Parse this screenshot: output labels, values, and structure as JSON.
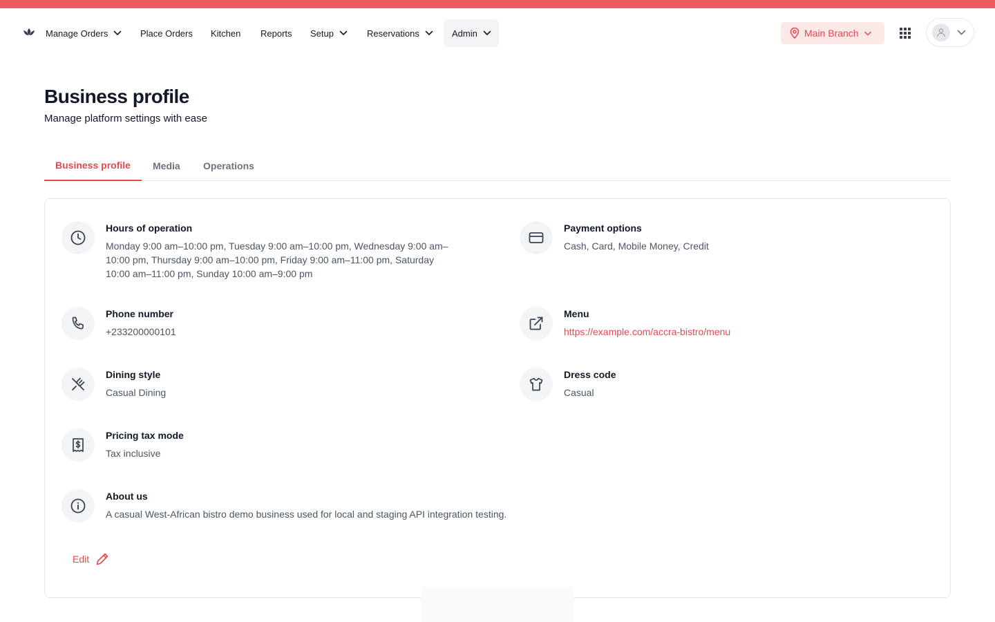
{
  "nav": {
    "items": [
      {
        "label": "Manage Orders",
        "has_dropdown": true
      },
      {
        "label": "Place Orders",
        "has_dropdown": false
      },
      {
        "label": "Kitchen",
        "has_dropdown": false
      },
      {
        "label": "Reports",
        "has_dropdown": false
      },
      {
        "label": "Setup",
        "has_dropdown": true
      },
      {
        "label": "Reservations",
        "has_dropdown": true
      },
      {
        "label": "Admin",
        "has_dropdown": true,
        "active": true
      }
    ],
    "branch": "Main Branch",
    "icons": {
      "logo": "lotus-logo-icon",
      "apps": "grid-apps-icon",
      "user": "user-avatar-icon",
      "branch": "map-pin-icon"
    }
  },
  "page": {
    "title": "Business profile",
    "subtitle": "Manage platform settings with ease"
  },
  "tabs": [
    {
      "label": "Business profile",
      "active": true
    },
    {
      "label": "Media",
      "active": false
    },
    {
      "label": "Operations",
      "active": false
    }
  ],
  "profile": {
    "hours": {
      "label": "Hours of operation",
      "value_lines": [
        "Monday 9:00 am–10:00 pm, Tuesday 9:00 am–10:00 pm, Wednesday 9:00 am–",
        "10:00 pm, Thursday 9:00 am–10:00 pm, Friday 9:00 am–11:00 pm, Saturday",
        "10:00 am–11:00 pm, Sunday 10:00 am–9:00 pm"
      ],
      "icon": "clock-icon"
    },
    "payment": {
      "label": "Payment options",
      "value": "Cash, Card, Mobile Money, Credit",
      "icon": "credit-card-icon"
    },
    "phone": {
      "label": "Phone number",
      "value": "+233200000101",
      "icon": "phone-icon"
    },
    "menu": {
      "label": "Menu",
      "value": "https://example.com/accra-bistro/menu",
      "icon": "external-link-icon"
    },
    "dining": {
      "label": "Dining style",
      "value": "Casual Dining",
      "icon": "utensils-crossed-icon"
    },
    "dress": {
      "label": "Dress code",
      "value": "Casual",
      "icon": "shirt-icon"
    },
    "tax": {
      "label": "Pricing tax mode",
      "value": "Tax inclusive",
      "icon": "receipt-icon"
    },
    "about": {
      "label": "About us",
      "value": "A casual West-African bistro demo business used for local and staging API integration testing.",
      "icon": "info-icon"
    }
  },
  "actions": {
    "edit_label": "Edit",
    "edit_icon": "pencil-icon"
  },
  "colors": {
    "accent": "#e5484d",
    "top_strip": "#ee5b5f",
    "branch_bg": "#fde8e8",
    "muted_text": "#4b5563",
    "icon_bg": "#f3f4f6"
  }
}
